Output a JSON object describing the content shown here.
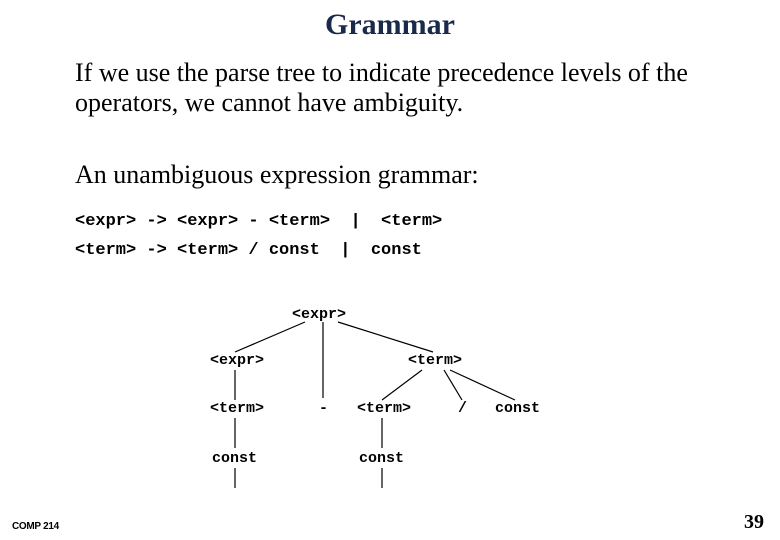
{
  "title": "Grammar",
  "para1": "If we use the parse tree to indicate precedence levels of the operators, we cannot have ambiguity.",
  "para2": "An unambiguous expression grammar:",
  "rules": {
    "line1": "<expr> -> <expr> - <term>  |  <term>",
    "line2": "<term> -> <term> / const  |  const"
  },
  "tree": {
    "n_root": "<expr>",
    "n_expr2": "<expr>",
    "n_minus": "-",
    "n_term_r": "<term>",
    "n_term_l": "<term>",
    "n_term_m": "<term>",
    "n_slash": "/",
    "n_const_r": "const",
    "n_const_l": "const",
    "n_const_m": "const"
  },
  "footer": {
    "course": "COMP 214",
    "page": "39"
  }
}
